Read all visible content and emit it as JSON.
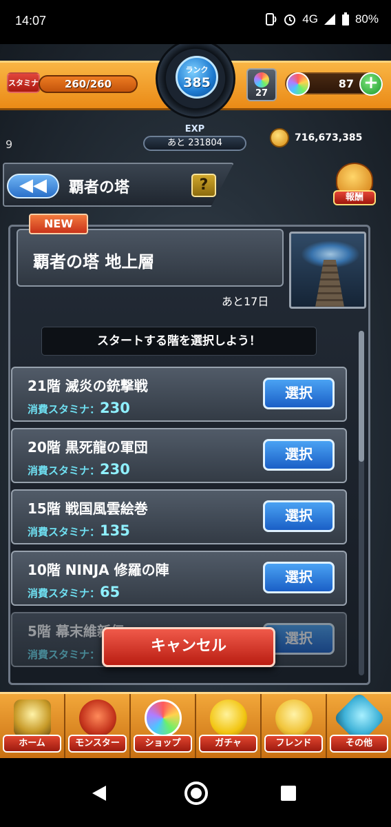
{
  "status_bar": {
    "time": "14:07",
    "network": "4G",
    "battery": "80%",
    "icons": [
      "nfc-icon",
      "alarm-icon",
      "signal-icon",
      "battery-icon"
    ]
  },
  "hud": {
    "stamina_label": "スタミナ",
    "stamina_value": "260/260",
    "rank_label": "ランク",
    "rank_value": "385",
    "orb_box_count": "27",
    "orb_count": "87",
    "plus_label": "+",
    "exp_label": "EXP",
    "exp_remaining": "あと 231804",
    "level_number": "9",
    "gold": "716,673,385"
  },
  "header": {
    "back_label": "◀◀",
    "title": "覇者の塔",
    "help_label": "?",
    "reward_label": "報酬"
  },
  "quest": {
    "new_badge": "NEW",
    "name": "覇者の塔 地上層",
    "days_left": "あと17日",
    "subtitle": "スタートする階を選択しよう！"
  },
  "floors": [
    {
      "name": "21階 滅炎の銃撃戦",
      "stamina_label": "消費スタミナ：",
      "stamina": "230",
      "button": "選択"
    },
    {
      "name": "20階 黒死龍の軍団",
      "stamina_label": "消費スタミナ：",
      "stamina": "230",
      "button": "選択"
    },
    {
      "name": "15階 戦国風雲絵巻",
      "stamina_label": "消費スタミナ：",
      "stamina": "135",
      "button": "選択"
    },
    {
      "name": "10階 NINJA 修羅の陣",
      "stamina_label": "消費スタミナ：",
      "stamina": "65",
      "button": "選択"
    },
    {
      "name": "5階 幕末維新伝",
      "stamina_label": "消費スタミナ：",
      "stamina": "",
      "button": "選択"
    }
  ],
  "cancel_label": "キャンセル",
  "bottom_nav": [
    {
      "label": "ホーム",
      "icon": "home-icon"
    },
    {
      "label": "モンスター",
      "icon": "monster-icon"
    },
    {
      "label": "ショップ",
      "icon": "shop-icon"
    },
    {
      "label": "ガチャ",
      "icon": "gacha-icon"
    },
    {
      "label": "フレンド",
      "icon": "friend-icon"
    },
    {
      "label": "その他",
      "icon": "other-icon"
    }
  ],
  "colors": {
    "accent_orange": "#f2a73a",
    "button_blue": "#1a5fc6",
    "cancel_red": "#b91d12",
    "stamina_cyan": "#6fe0f2"
  }
}
